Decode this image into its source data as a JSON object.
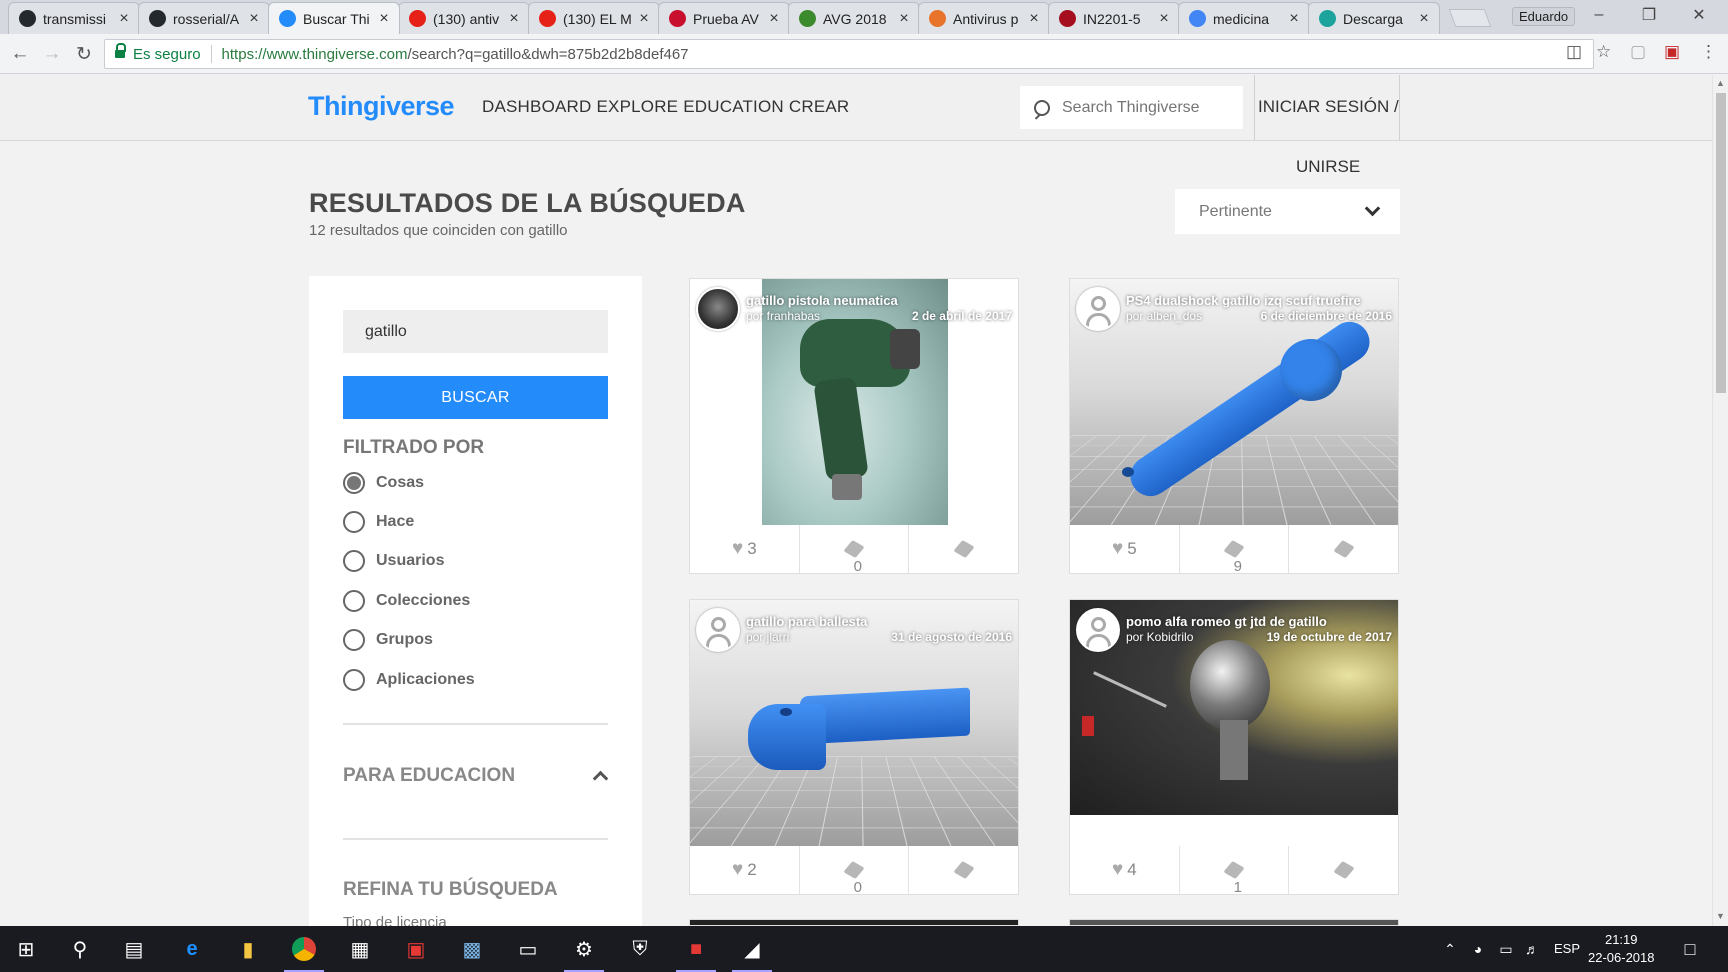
{
  "browser": {
    "tabs": [
      {
        "title": "transmissi",
        "favicon_color": "#24292e",
        "favicon": "github-icon"
      },
      {
        "title": "rosserial/A",
        "favicon_color": "#24292e",
        "favicon": "github-icon"
      },
      {
        "title": "Buscar Thi",
        "favicon_color": "#248bfb",
        "favicon": "thingiverse-icon",
        "active": true
      },
      {
        "title": "(130) antiv",
        "favicon_color": "#e62117",
        "favicon": "youtube-icon"
      },
      {
        "title": "(130) EL M",
        "favicon_color": "#e62117",
        "favicon": "youtube-icon"
      },
      {
        "title": "Prueba AV",
        "favicon_color": "#c8102e",
        "favicon": "av-icon"
      },
      {
        "title": "AVG 2018",
        "favicon_color": "#3c8a2e",
        "favicon": "avg-icon"
      },
      {
        "title": "Antivirus p",
        "favicon_color": "#e8742b",
        "favicon": "avg-icon"
      },
      {
        "title": "IN2201-5",
        "favicon_color": "#a50e1e",
        "favicon": "uchile-icon"
      },
      {
        "title": "medicina",
        "favicon_color": "#4285f4",
        "favicon": "google-icon"
      },
      {
        "title": "Descarga",
        "favicon_color": "#1ba39c",
        "favicon": "s-icon"
      }
    ],
    "profile_name": "Eduardo",
    "secure_label": "Es seguro",
    "url_host": "https://www.thingiverse.com",
    "url_rest": "/search?q=gatillo&dwh=875b2d2b8def467"
  },
  "header": {
    "logo": "Thingiverse",
    "nav": [
      "DASHBOARD",
      "EXPLORE",
      "EDUCATION",
      "CREAR"
    ],
    "search_placeholder": "Search Thingiverse",
    "login": "INICIAR SESIÓN /",
    "join": "UNIRSE"
  },
  "results": {
    "title": "RESULTADOS DE LA BÚSQUEDA",
    "count_text": "12 resultados que coinciden con gatillo",
    "sort_value": "Pertinente"
  },
  "sidebar": {
    "query": "gatillo",
    "search_button": "BUSCAR",
    "filter_heading": "FILTRADO POR",
    "filters": [
      {
        "label": "Cosas",
        "checked": true
      },
      {
        "label": "Hace",
        "checked": false
      },
      {
        "label": "Usuarios",
        "checked": false
      },
      {
        "label": "Colecciones",
        "checked": false
      },
      {
        "label": "Grupos",
        "checked": false
      },
      {
        "label": "Aplicaciones",
        "checked": false
      }
    ],
    "education_heading": "PARA EDUCACION",
    "refine_heading": "REFINA TU BÚSQUEDA",
    "license_label": "Tipo de licencia"
  },
  "cards": [
    {
      "title": "gatillo pistola neumatica",
      "author": "por franhabas",
      "date": "2 de abril de 2017",
      "likes": "3",
      "collects": "0",
      "image": "photo-impact-wrench"
    },
    {
      "title": "PS4 dualshock gatillo izq scuf truefire",
      "author": "por alben_dos",
      "date": "6 de diciembre de 2016",
      "likes": "5",
      "collects": "9",
      "image": "render-blue-lever"
    },
    {
      "title": "gatillo para ballesta",
      "author": "por jlarri",
      "date": "31 de agosto de 2016",
      "likes": "2",
      "collects": "0",
      "image": "render-blue-hook"
    },
    {
      "title": "pomo alfa romeo gt jtd de gatillo",
      "author": "por Kobidrilo",
      "date": "19 de octubre de 2017",
      "likes": "4",
      "collects": "1",
      "image": "photo-gear-knob"
    }
  ],
  "taskbar": {
    "language": "ESP",
    "time": "21:19",
    "date": "22-06-2018"
  }
}
